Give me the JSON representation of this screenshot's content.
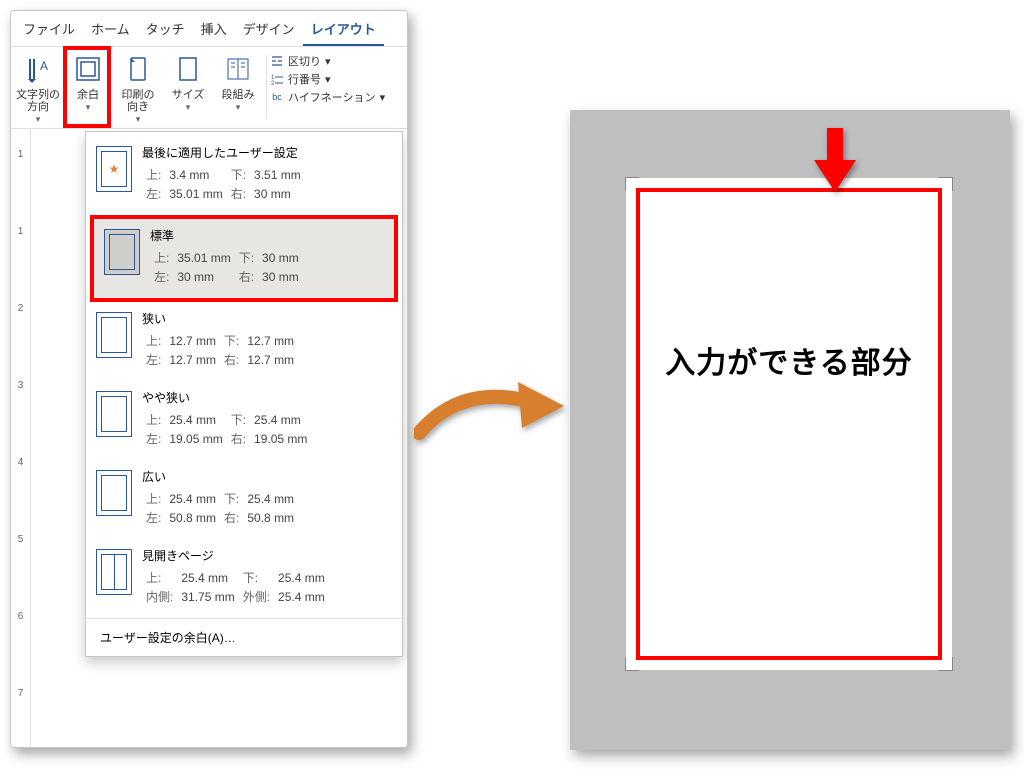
{
  "tabs": {
    "file": "ファイル",
    "home": "ホーム",
    "touch": "タッチ",
    "insert": "挿入",
    "design": "デザイン",
    "layout": "レイアウト"
  },
  "ribbon": {
    "textDirection": "文字列の\n方向",
    "margins": "余白",
    "orientation": "印刷の\n向き",
    "size": "サイズ",
    "columns": "段組み",
    "breaks": "区切り",
    "lineNumbers": "行番号",
    "hyphenation": "ハイフネーション"
  },
  "rulerTicks": [
    "1",
    "1",
    "2",
    "3",
    "4",
    "5",
    "6",
    "7"
  ],
  "dropdown": {
    "lastTitle": "最後に適用したユーザー設定",
    "last": {
      "top": "3.4 mm",
      "bottom": "3.51 mm",
      "left": "35.01 mm",
      "right": "30 mm"
    },
    "normalTitle": "標準",
    "normal": {
      "top": "35.01 mm",
      "bottom": "30 mm",
      "left": "30 mm",
      "right": "30 mm"
    },
    "narrowTitle": "狭い",
    "narrow": {
      "top": "12.7 mm",
      "bottom": "12.7 mm",
      "left": "12.7 mm",
      "right": "12.7 mm"
    },
    "yayaTitle": "やや狭い",
    "yaya": {
      "top": "25.4 mm",
      "bottom": "25.4 mm",
      "left": "19.05 mm",
      "right": "19.05 mm"
    },
    "wideTitle": "広い",
    "wide": {
      "top": "25.4 mm",
      "bottom": "25.4 mm",
      "left": "50.8 mm",
      "right": "50.8 mm"
    },
    "bookTitle": "見開きページ",
    "book": {
      "top": "25.4 mm",
      "bottom": "25.4 mm",
      "inner": "31.75 mm",
      "outer": "25.4 mm"
    },
    "labels": {
      "top": "上:",
      "bottom": "下:",
      "left": "左:",
      "right": "右:",
      "inner": "内側:",
      "outer": "外側:"
    },
    "footer": "ユーザー設定の余白(A)…"
  },
  "illustration": {
    "label": "入力ができる部分"
  }
}
